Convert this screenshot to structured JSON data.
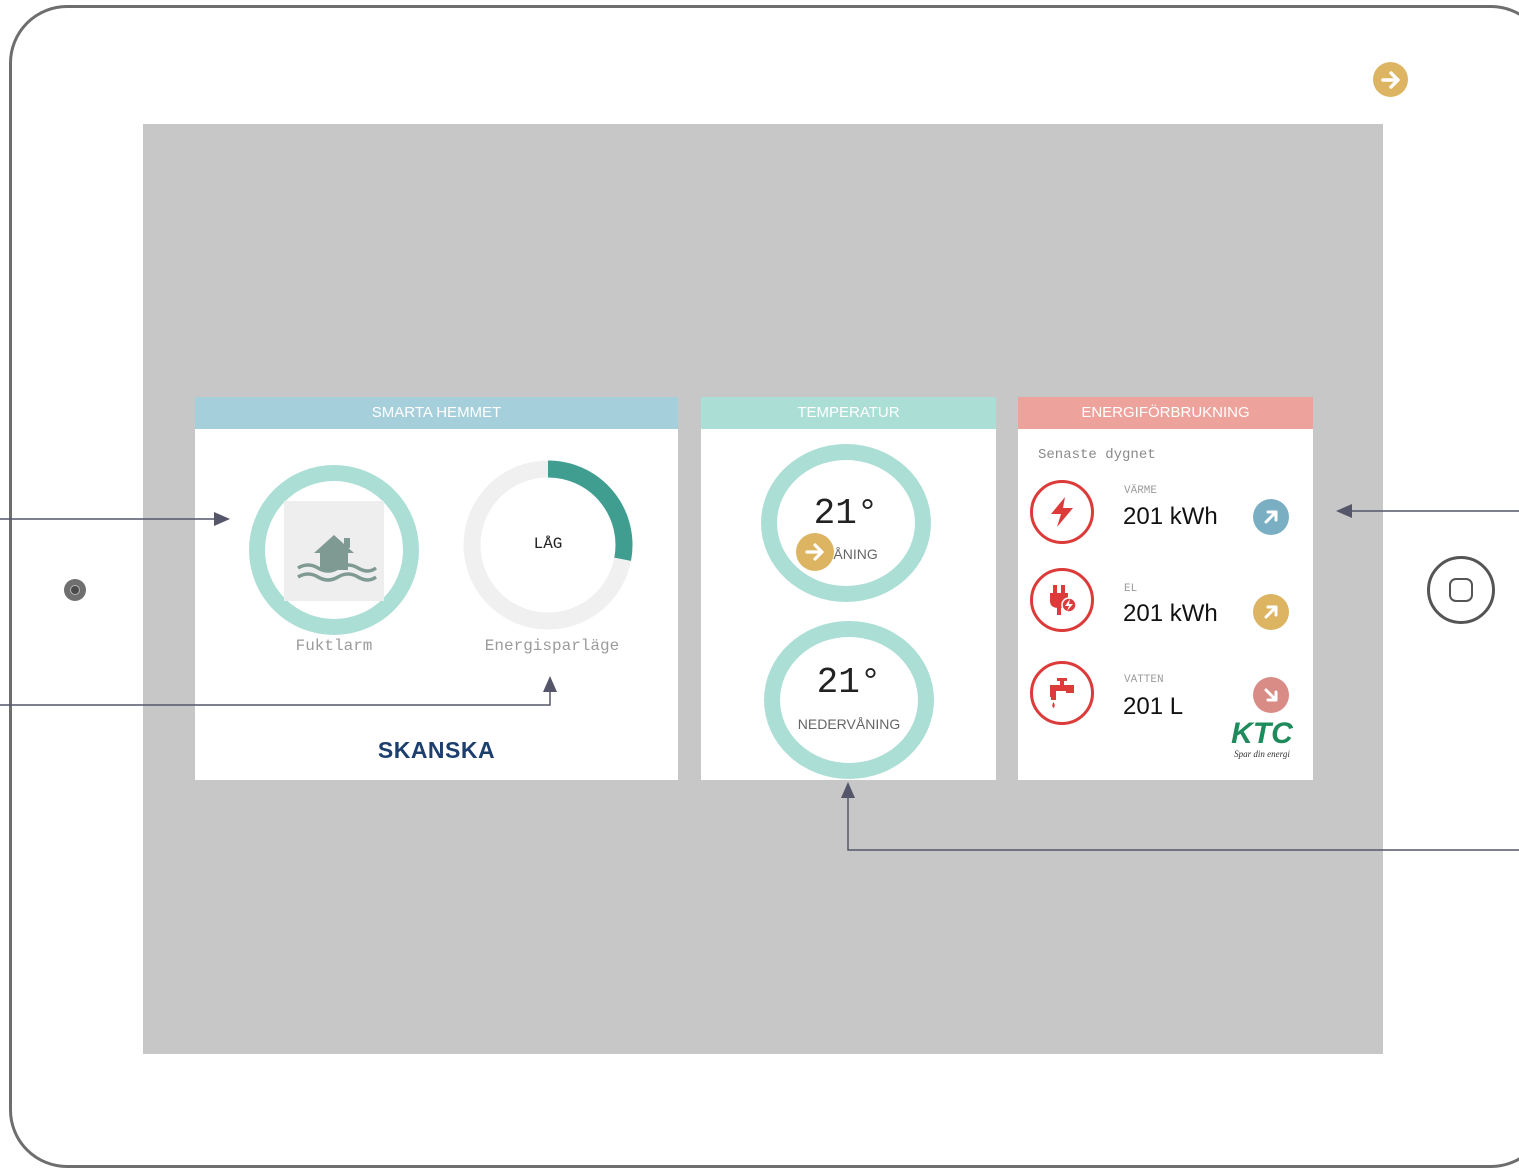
{
  "panels": {
    "smart_home": {
      "title": "SMARTA HEMMET",
      "humidity_label": "Fuktlarm",
      "energy_saving_label": "Energisparläge",
      "energy_saving_value": "LÅG",
      "energy_saving_level": 0.28,
      "brand": "SKANSKA"
    },
    "temperature": {
      "title": "TEMPERATUR",
      "upper": {
        "value": "21°",
        "name": "RVÅNING"
      },
      "lower": {
        "value": "21°",
        "name": "NEDERVÅNING"
      }
    },
    "energy": {
      "title": "ENERGIFÖRBRUKNING",
      "period": "Senaste dygnet",
      "rows": [
        {
          "tag": "VÄRME",
          "value": "201 kWh",
          "icon": "lightning-icon",
          "trend": "up",
          "trend_color": "#7aaec2"
        },
        {
          "tag": "EL",
          "value": "201 kWh",
          "icon": "plug-icon",
          "trend": "up",
          "trend_color": "#dcb462"
        },
        {
          "tag": "VATTEN",
          "value": "201 L",
          "icon": "faucet-icon",
          "trend": "down",
          "trend_color": "#d98b86"
        }
      ],
      "brand": "KTC",
      "brand_tagline": "Spar din energi"
    }
  },
  "colors": {
    "smart_home_header": "#a6cfdc",
    "temperature_header": "#abded5",
    "energy_header": "#eea29c",
    "ring": "#abded5",
    "accent_gold": "#dcb462",
    "alert_red": "#dd3a3a"
  }
}
